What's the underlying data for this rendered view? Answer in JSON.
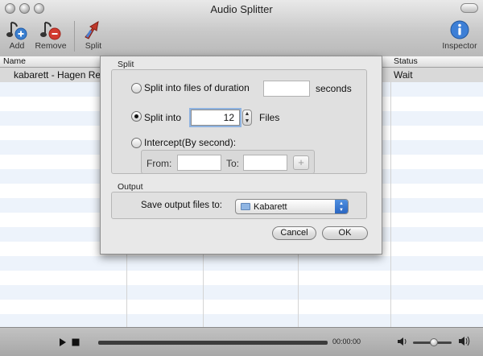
{
  "window": {
    "title": "Audio Splitter"
  },
  "toolbar": {
    "add_label": "Add",
    "remove_label": "Remove",
    "split_label": "Split",
    "inspector_label": "Inspector"
  },
  "table": {
    "columns": {
      "name": "Name",
      "status": "Status"
    },
    "rows": [
      {
        "name": "kabarett - Hagen Re",
        "status": "Wait"
      }
    ]
  },
  "sheet": {
    "split_section_label": "Split",
    "duration_option_label": "Split into files of duration",
    "duration_value": "",
    "duration_unit": "seconds",
    "count_option_label": "Split into",
    "count_value": "12",
    "count_unit": "Files",
    "intercept_option_label": "Intercept(By second):",
    "from_label": "From:",
    "from_value": "",
    "to_label": "To:",
    "to_value": "",
    "add_range_symbol": "+",
    "selected_option": "count",
    "output_section_label": "Output",
    "save_label": "Save output files to:",
    "folder_value": "Kabarett",
    "cancel_label": "Cancel",
    "ok_label": "OK"
  },
  "player": {
    "time": "00:00:00",
    "volume_level": 0.55
  },
  "icons": {
    "add": "add-note-icon",
    "remove": "remove-note-icon",
    "split": "split-arrow-icon",
    "inspector": "info-icon",
    "play": "play-icon",
    "stop": "stop-icon",
    "volume": "speaker-icon"
  },
  "colors": {
    "accent_blue": "#2a66c2",
    "add_green": "#3a7fd0",
    "remove_red": "#d23b2f",
    "inspector_blue": "#3d7fd6"
  }
}
